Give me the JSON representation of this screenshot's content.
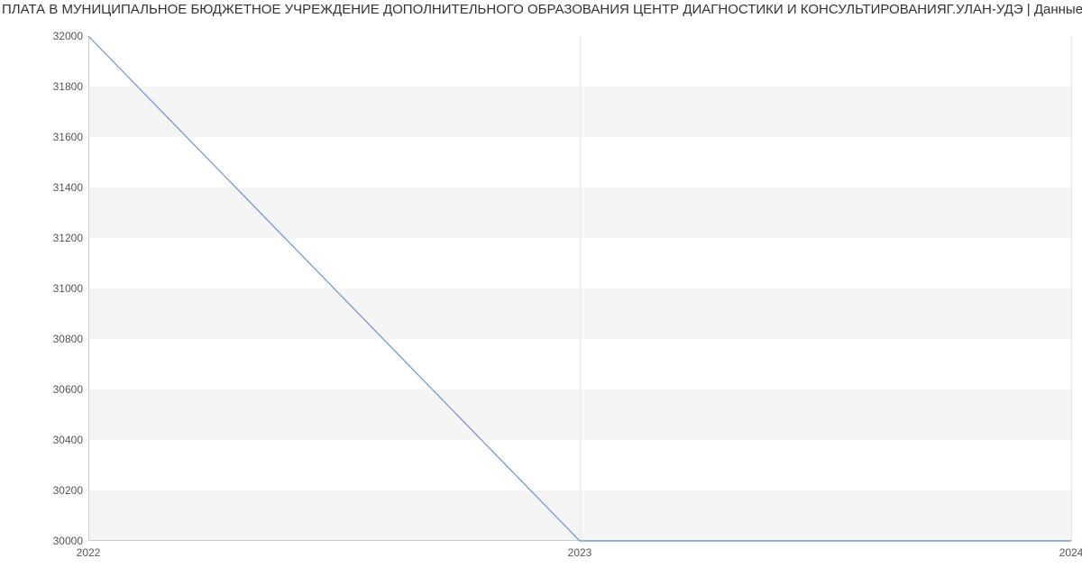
{
  "chart_data": {
    "type": "line",
    "title": "ПЛАТА В МУНИЦИПАЛЬНОЕ БЮДЖЕТНОЕ УЧРЕЖДЕНИЕ ДОПОЛНИТЕЛЬНОГО ОБРАЗОВАНИЯ ЦЕНТР ДИАГНОСТИКИ И КОНСУЛЬТИРОВАНИЯГ.УЛАН-УДЭ | Данные mnogo.w",
    "xlabel": "",
    "ylabel": "",
    "ylim": [
      30000,
      32000
    ],
    "y_ticks": [
      30000,
      30200,
      30400,
      30600,
      30800,
      31000,
      31200,
      31400,
      31600,
      31800,
      32000
    ],
    "x_ticks": [
      "2022",
      "2023",
      "2024"
    ],
    "x": [
      2022,
      2023,
      2024
    ],
    "values": [
      32000,
      30000,
      30000
    ]
  }
}
